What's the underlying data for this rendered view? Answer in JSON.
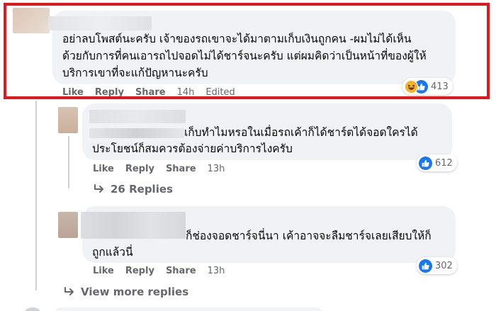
{
  "comments": [
    {
      "text_lines": [
        "อย่าลบโพสต์นะครับ เจ้าของรถเขาจะได้มาตามเก็บเงินถูกคน -ผมไม่ได้เห็น",
        "ด้วยกับการที่คนเอารถไปจอดไม่ได้ชาร์จนะครับ แต่ผมคิดว่าเป็นหน้าที่ของผู้ให้",
        "บริการเขาที่จะแก้ปัญหานะครับ"
      ],
      "actions": {
        "like": "Like",
        "reply": "Reply",
        "share": "Share",
        "time": "14h",
        "edited": "Edited"
      },
      "reactions": {
        "icons": [
          "haha-icon",
          "like-icon"
        ],
        "count": "413"
      }
    },
    {
      "text_lines": [
        "เก็บทำไมหรอในเมื่อรถเค้าก็ได้ชาร์ตได้จอดใครได้",
        "ประโยชน์ก็สมควรต้องจ่ายค่าบริการไงครับ"
      ],
      "actions": {
        "like": "Like",
        "reply": "Reply",
        "share": "Share",
        "time": "13h"
      },
      "reactions": {
        "icons": [
          "like-icon"
        ],
        "count": "612"
      },
      "replies_link": "26 Replies"
    },
    {
      "text_lines": [
        "ก็ช่องจอดชาร์จนี่นา เค้าอาจจะลืมชาร์จเลยเสียบให้ก็",
        "ถูกแล้วนี่"
      ],
      "actions": {
        "like": "Like",
        "reply": "Reply",
        "share": "Share",
        "time": "13h"
      },
      "reactions": {
        "icons": [
          "like-icon"
        ],
        "count": "302"
      }
    }
  ],
  "view_more_replies": "View more replies",
  "colors": {
    "highlight_border": "#e8141b",
    "bubble_bg": "#f0f2f5",
    "like_blue": "#1877f2",
    "haha_yellow": "#f7b125",
    "secondary_text": "#65676b"
  }
}
